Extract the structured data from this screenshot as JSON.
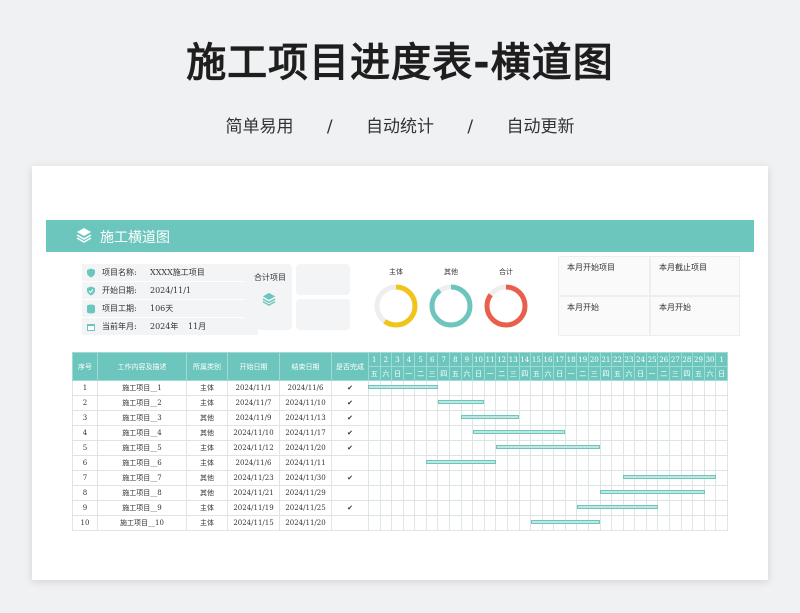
{
  "hero": {
    "title": "施工项目进度表-横道图",
    "subtitle": [
      "简单易用",
      "/",
      "自动统计",
      "/",
      "自动更新"
    ]
  },
  "banner": {
    "title": "施工横道图",
    "icon": "layers-icon"
  },
  "info": [
    {
      "label": "项目名称:",
      "value": "XXXX施工项目",
      "icon": "shield-icon"
    },
    {
      "label": "开始日期:",
      "value": "2024/11/1",
      "icon": "check-shield-icon"
    },
    {
      "label": "项目工期:",
      "value": "106天",
      "icon": "database-icon"
    },
    {
      "label": "当前年月:",
      "value": "2024年",
      "value2": "11月",
      "icon": "calendar-icon"
    }
  ],
  "summary": {
    "label": "合计项目",
    "icon": "layers-icon"
  },
  "donuts": [
    {
      "label": "主体",
      "color": "#f0c419",
      "fraction": 0.6
    },
    {
      "label": "其他",
      "color": "#6cc6bd",
      "fraction": 0.9
    },
    {
      "label": "合计",
      "color": "#e8604c",
      "fraction": 0.85
    }
  ],
  "month_boxes": [
    "本月开始项目",
    "本月截止项目",
    "本月开始",
    "本月开始"
  ],
  "colors": {
    "accent": "#6cc6bd",
    "bar": "#bfe7e2"
  },
  "table": {
    "headers": [
      "序号",
      "工作内容及描述",
      "所属类别",
      "开始日期",
      "结束日期",
      "是否完成"
    ],
    "days": [
      "1",
      "2",
      "3",
      "4",
      "5",
      "6",
      "7",
      "8",
      "9",
      "10",
      "11",
      "12",
      "13",
      "14",
      "15",
      "16",
      "17",
      "18",
      "19",
      "20",
      "21",
      "22",
      "23",
      "24",
      "25",
      "26",
      "27",
      "28",
      "29",
      "30",
      "1"
    ],
    "weekdays": [
      "五",
      "六",
      "日",
      "一",
      "二",
      "三",
      "四",
      "五",
      "六",
      "日",
      "一",
      "二",
      "三",
      "四",
      "五",
      "六",
      "日",
      "一",
      "二",
      "三",
      "四",
      "五",
      "六",
      "日",
      "一",
      "二",
      "三",
      "四",
      "五",
      "六",
      "日"
    ],
    "rows": [
      {
        "no": "1",
        "task": "施工项目__1",
        "cat": "主体",
        "start": "2024/11/1",
        "end": "2024/11/6",
        "done": "✔",
        "s": 1,
        "e": 6
      },
      {
        "no": "2",
        "task": "施工项目__2",
        "cat": "主体",
        "start": "2024/11/7",
        "end": "2024/11/10",
        "done": "✔",
        "s": 7,
        "e": 10
      },
      {
        "no": "3",
        "task": "施工项目__3",
        "cat": "其他",
        "start": "2024/11/9",
        "end": "2024/11/13",
        "done": "✔",
        "s": 9,
        "e": 13
      },
      {
        "no": "4",
        "task": "施工项目__4",
        "cat": "其他",
        "start": "2024/11/10",
        "end": "2024/11/17",
        "done": "✔",
        "s": 10,
        "e": 17
      },
      {
        "no": "5",
        "task": "施工项目__5",
        "cat": "主体",
        "start": "2024/11/12",
        "end": "2024/11/20",
        "done": "✔",
        "s": 12,
        "e": 20
      },
      {
        "no": "6",
        "task": "施工项目__6",
        "cat": "主体",
        "start": "2024/11/6",
        "end": "2024/11/11",
        "done": "",
        "s": 6,
        "e": 11
      },
      {
        "no": "7",
        "task": "施工项目__7",
        "cat": "其他",
        "start": "2024/11/23",
        "end": "2024/11/30",
        "done": "✔",
        "s": 23,
        "e": 30
      },
      {
        "no": "8",
        "task": "施工项目__8",
        "cat": "其他",
        "start": "2024/11/21",
        "end": "2024/11/29",
        "done": "",
        "s": 21,
        "e": 29
      },
      {
        "no": "9",
        "task": "施工项目__9",
        "cat": "主体",
        "start": "2024/11/19",
        "end": "2024/11/25",
        "done": "✔",
        "s": 19,
        "e": 25
      },
      {
        "no": "10",
        "task": "施工项目__10",
        "cat": "主体",
        "start": "2024/11/15",
        "end": "2024/11/20",
        "done": "",
        "s": 15,
        "e": 20
      }
    ]
  }
}
